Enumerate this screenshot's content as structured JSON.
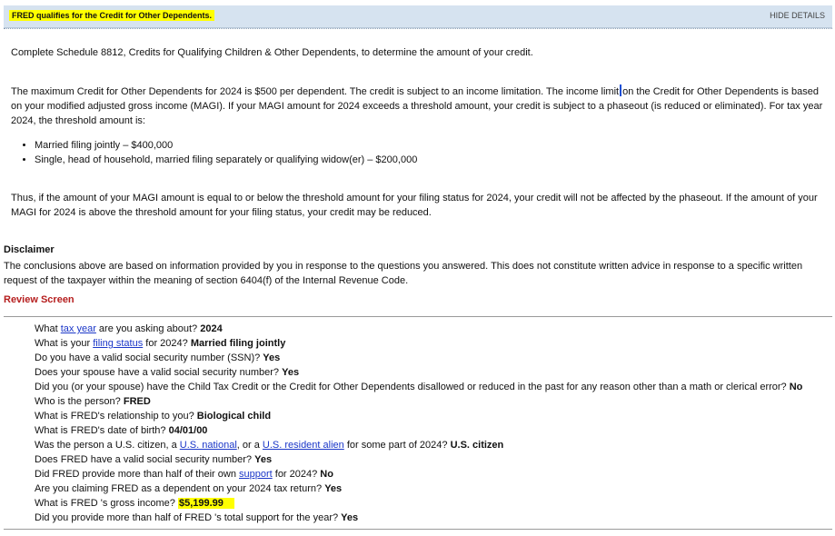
{
  "header": {
    "title": "FRED qualifies for the Credit for Other Dependents.",
    "hide_details": "HIDE DETAILS"
  },
  "body": {
    "intro": "Complete Schedule 8812, Credits for Qualifying Children & Other Dependents, to determine the amount of your credit.",
    "max_credit_a": "The maximum Credit for Other Dependents for 2024 is $500 per dependent. The credit is subject to an income limitation. The income limit",
    "max_credit_b": "on the Credit for Other Dependents is based on your modified adjusted gross income (MAGI). If your MAGI amount for 2024 exceeds a threshold amount, your credit is subject to a phaseout (is reduced or eliminated). For tax year 2024, the threshold amount is:",
    "bullets": [
      "Married filing jointly – $400,000",
      "Single, head of household, married filing separately or qualifying widow(er) – $200,000"
    ],
    "thus": "Thus, if the amount of your MAGI amount is equal to or below the threshold amount for your filing status for 2024, your credit will not be affected by the phaseout. If the amount of your MAGI for 2024 is above the threshold amount for your filing status, your credit may be reduced."
  },
  "disclaimer": {
    "title": "Disclaimer",
    "text": "The conclusions above are based on information provided by you in response to the questions you answered. This does not constitute written advice in response to a specific written request of the taxpayer within the meaning of section 6404(f) of the Internal Revenue Code."
  },
  "review_screen_label": "Review Screen",
  "qa": [
    {
      "pre": "What ",
      "link": "tax year",
      "post": " are you asking about? ",
      "answer": "2024"
    },
    {
      "pre": "What is your ",
      "link": "filing status",
      "post": " for 2024? ",
      "answer": "Married filing jointly"
    },
    {
      "pre": "Do you have a valid social security number (SSN)? ",
      "answer": "Yes"
    },
    {
      "pre": "Does your spouse have a valid social security number? ",
      "answer": "Yes"
    },
    {
      "pre": "Did you (or your spouse) have the Child Tax Credit or the Credit for Other Dependents disallowed or reduced in the past for any reason other than a math or clerical error? ",
      "answer": "No"
    },
    {
      "pre": "Who is the person? ",
      "answer": "FRED"
    },
    {
      "pre": "What is FRED's relationship to you? ",
      "answer": "Biological child"
    },
    {
      "pre": "What is FRED's date of birth? ",
      "answer": "04/01/00"
    },
    {
      "pre": "Was the person a U.S. citizen, a ",
      "link": "U.S. national",
      "post": ", or a ",
      "link2": "U.S. resident alien",
      "post2": " for some part of 2024? ",
      "answer": "U.S. citizen"
    },
    {
      "pre": "Does FRED have a valid social security number? ",
      "answer": "Yes"
    },
    {
      "pre": "Did FRED provide more than half of their own ",
      "link": "support",
      "post": " for 2024? ",
      "answer": "No"
    },
    {
      "pre": "Are you claiming FRED as a dependent on your 2024 tax return? ",
      "answer": "Yes"
    },
    {
      "pre": "What is FRED 's gross income? ",
      "answer": "$5,199.99",
      "highlight": true
    },
    {
      "pre": "Did you provide more than half of FRED 's total support for the year? ",
      "answer": "Yes"
    }
  ]
}
